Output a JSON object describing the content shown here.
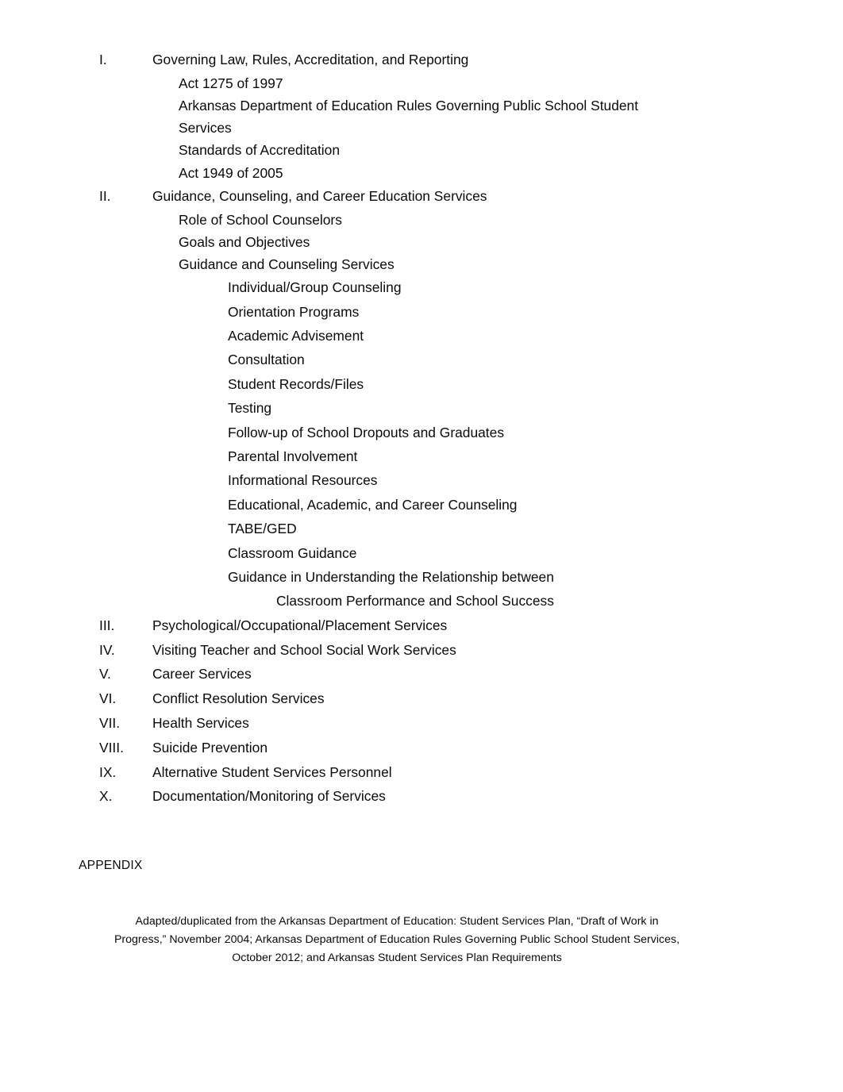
{
  "document": {
    "type": "table-of-contents",
    "background_color": "#ffffff",
    "text_color": "#0a0a0a"
  },
  "outline": {
    "entries": [
      {
        "level": 1,
        "number": "I.",
        "text": "Governing Law, Rules, Accreditation, and Reporting"
      },
      {
        "level": 2,
        "number": "",
        "text": "Act 1275 of 1997"
      },
      {
        "level": 2,
        "number": "",
        "text": "Arkansas Department of Education Rules Governing Public School Student Services"
      },
      {
        "level": 2,
        "number": "",
        "text": "Standards of Accreditation"
      },
      {
        "level": 2,
        "number": "",
        "text": "Act 1949 of 2005"
      },
      {
        "level": 1,
        "number": "II.",
        "text": "Guidance, Counseling, and Career Education Services"
      },
      {
        "level": 2,
        "number": "",
        "text": "Role of School Counselors"
      },
      {
        "level": 2,
        "number": "",
        "text": "Goals and Objectives"
      },
      {
        "level": 2,
        "number": "",
        "text": "Guidance and Counseling Services"
      },
      {
        "level": 3,
        "number": "",
        "text": "Individual/Group Counseling"
      },
      {
        "level": 3,
        "number": "",
        "text": "Orientation Programs"
      },
      {
        "level": 3,
        "number": "",
        "text": "Academic Advisement"
      },
      {
        "level": 3,
        "number": "",
        "text": "Consultation"
      },
      {
        "level": 3,
        "number": "",
        "text": "Student Records/Files"
      },
      {
        "level": 3,
        "number": "",
        "text": "Testing"
      },
      {
        "level": 3,
        "number": "",
        "text": "Follow-up of School Dropouts and Graduates"
      },
      {
        "level": 3,
        "number": "",
        "text": "Parental Involvement"
      },
      {
        "level": 3,
        "number": "",
        "text": "Informational Resources"
      },
      {
        "level": 3,
        "number": "",
        "text": "Educational, Academic, and Career Counseling"
      },
      {
        "level": 3,
        "number": "",
        "text": "TABE/GED"
      },
      {
        "level": 3,
        "number": "",
        "text": "Classroom Guidance"
      },
      {
        "level": 3,
        "number": "",
        "text": "Guidance in Understanding the Relationship between"
      },
      {
        "level": 4,
        "number": "",
        "text": "Classroom Performance and School Success"
      },
      {
        "level": 1,
        "number": "III.",
        "text": "Psychological/Occupational/Placement Services"
      },
      {
        "level": 1,
        "number": "IV.",
        "text": "Visiting Teacher and School Social Work Services"
      },
      {
        "level": 1,
        "number": "V.",
        "text": "Career Services"
      },
      {
        "level": 1,
        "number": "VI.",
        "text": "Conflict Resolution Services"
      },
      {
        "level": 1,
        "number": "VII.",
        "text": "Health Services"
      },
      {
        "level": 1,
        "number": "VIII.",
        "text": "Suicide Prevention"
      },
      {
        "level": 1,
        "number": "IX.",
        "text": "Alternative Student Services Personnel"
      },
      {
        "level": 1,
        "number": "X.",
        "text": "Documentation/Monitoring of Services"
      }
    ]
  },
  "appendix": {
    "heading": "APPENDIX"
  },
  "footer": {
    "lines": [
      "Adapted/duplicated from the Arkansas Department of Education: Student Services Plan, “Draft of Work in",
      "Progress,” November 2004; Arkansas Department of Education Rules Governing Public School Student Services,",
      "October 2012; and Arkansas Student Services Plan Requirements"
    ],
    "full_text": "Adapted/duplicated from the Arkansas Department of Education: Student Services Plan, “Draft of Work in Progress,” November 2004; Arkansas Department of Education Rules Governing Public School Student Services, October 2012; and Arkansas Student Services Plan Requirements"
  }
}
